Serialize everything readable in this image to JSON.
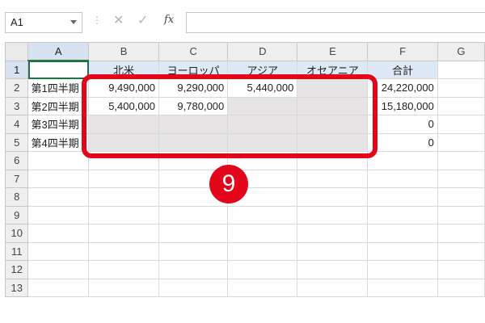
{
  "formula_bar": {
    "name_box": "A1",
    "separator": "⋮",
    "cancel_symbol": "✕",
    "enter_symbol": "✓",
    "fx_label": "fx",
    "formula": ""
  },
  "sheet": {
    "columns": [
      "A",
      "B",
      "C",
      "D",
      "E",
      "F",
      "G"
    ],
    "rows": [
      "1",
      "2",
      "3",
      "4",
      "5",
      "6",
      "7",
      "8",
      "9",
      "10",
      "11",
      "12",
      "13"
    ],
    "header_row": {
      "A": "",
      "B": "北米",
      "C": "ヨーロッパ",
      "D": "アジア",
      "E": "オセアニア",
      "F": "合計"
    },
    "data_rows": [
      {
        "A": "第1四半期",
        "B": "9,490,000",
        "C": "9,290,000",
        "D": "5,440,000",
        "E": "",
        "F": "24,220,000"
      },
      {
        "A": "第2四半期",
        "B": "5,400,000",
        "C": "9,780,000",
        "D": "",
        "E": "",
        "F": "15,180,000"
      },
      {
        "A": "第3四半期",
        "B": "",
        "C": "",
        "D": "",
        "E": "",
        "F": "0"
      },
      {
        "A": "第4四半期",
        "B": "",
        "C": "",
        "D": "",
        "E": "",
        "F": "0"
      }
    ]
  },
  "annotation": {
    "step_number": "9",
    "highlight_color": "#e3061a"
  },
  "colors": {
    "selection_green": "#1e7145",
    "empty_range_gray": "#e6e4e4",
    "header_fill": "#dde9f5"
  }
}
